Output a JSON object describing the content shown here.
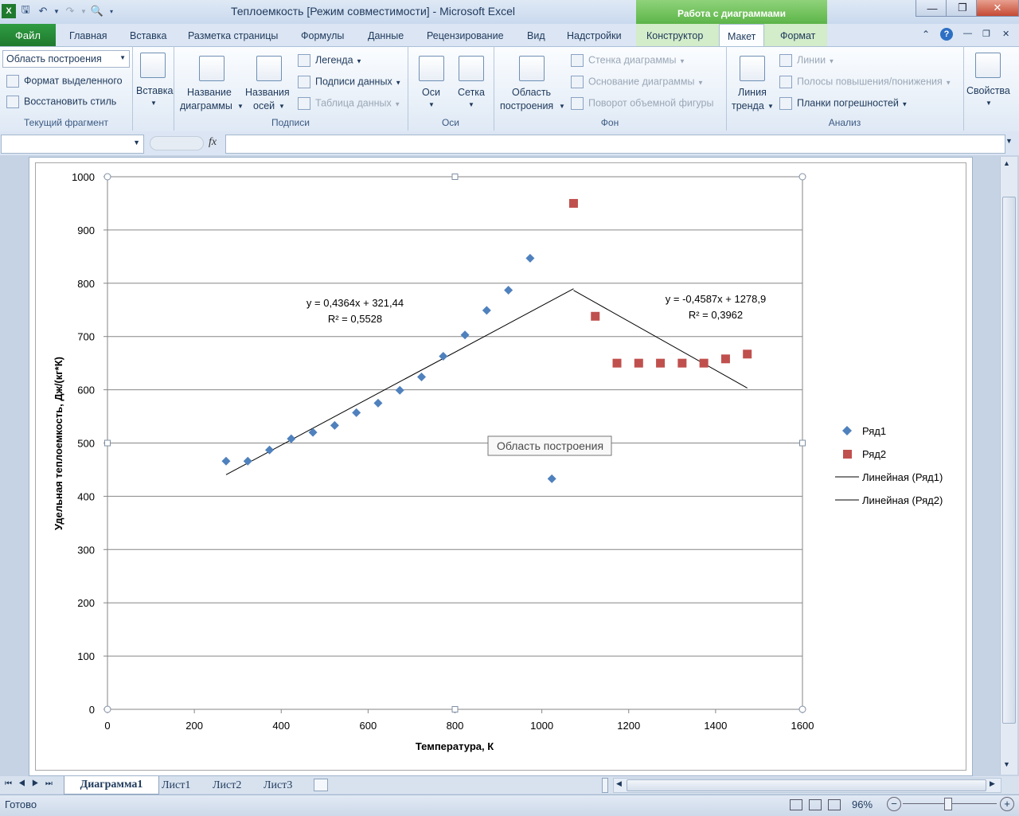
{
  "app": {
    "title": "Теплоемкость  [Режим совместимости]  -  Microsoft Excel",
    "context_tab_header": "Работа с диаграммами"
  },
  "tabs": [
    "Файл",
    "Главная",
    "Вставка",
    "Разметка страницы",
    "Формулы",
    "Данные",
    "Рецензирование",
    "Вид",
    "Надстройки",
    "Конструктор",
    "Макет",
    "Формат"
  ],
  "ribbon": {
    "current_fragment": {
      "selector_value": "Область построения",
      "format_selection": "Формат выделенного",
      "reset_style": "Восстановить стиль",
      "label": "Текущий фрагмент"
    },
    "insert": {
      "label": "Вставка"
    },
    "labels_group": {
      "chart_title_1": "Название",
      "chart_title_2": "диаграммы",
      "axis_titles_1": "Названия",
      "axis_titles_2": "осей",
      "legend": "Легенда",
      "data_labels": "Подписи данных",
      "data_table": "Таблица данных",
      "label": "Подписи"
    },
    "axes_group": {
      "axes": "Оси",
      "grid": "Сетка",
      "label": "Оси"
    },
    "background_group": {
      "plot_area_1": "Область",
      "plot_area_2": "построения",
      "chart_wall": "Стенка диаграммы",
      "chart_floor": "Основание диаграммы",
      "rotation_3d": "Поворот объемной фигуры",
      "label": "Фон"
    },
    "analysis_group": {
      "trendline_1": "Линия",
      "trendline_2": "тренда",
      "lines": "Линии",
      "updown_bars": "Полосы повышения/понижения",
      "error_bars": "Планки погрешностей",
      "label": "Анализ"
    },
    "properties_group": {
      "properties": "Свойства"
    }
  },
  "formula_bar": {
    "fx": "fx",
    "value": ""
  },
  "chart_data": {
    "type": "scatter",
    "xlabel": "Температура, К",
    "ylabel": "Удельная теплоемкость, Дж/(кг*К)",
    "xlim": [
      0,
      1600
    ],
    "ylim": [
      0,
      1000
    ],
    "xticks": [
      "0",
      "200",
      "400",
      "600",
      "800",
      "1000",
      "1200",
      "1400",
      "1600"
    ],
    "yticks": [
      "0",
      "100",
      "200",
      "300",
      "400",
      "500",
      "600",
      "700",
      "800",
      "900",
      "1000"
    ],
    "grid": "horizontal",
    "legend_position": "right",
    "series": [
      {
        "name": "Ряд1",
        "marker": "diamond",
        "color": "#4f81bd",
        "x": [
          273,
          323,
          373,
          423,
          473,
          523,
          573,
          623,
          673,
          723,
          773,
          823,
          873,
          923,
          973,
          1023
        ],
        "y": [
          466,
          466,
          487,
          508,
          520,
          533,
          557,
          575,
          599,
          624,
          663,
          703,
          749,
          787,
          847,
          433
        ]
      },
      {
        "name": "Ряд2",
        "marker": "square",
        "color": "#c0504d",
        "x": [
          1073,
          1123,
          1173,
          1223,
          1273,
          1323,
          1373,
          1423,
          1473
        ],
        "y": [
          950,
          738,
          650,
          650,
          650,
          650,
          650,
          658,
          667
        ]
      }
    ],
    "trendlines": [
      {
        "name": "Линейная (Ряд1)",
        "slope": 0.4364,
        "intercept": 321.44,
        "x_range": [
          273,
          1073
        ],
        "equation": "y = 0,4364x + 321,44",
        "r2": "R² = 0,5528"
      },
      {
        "name": "Линейная (Ряд2)",
        "slope": -0.4587,
        "intercept": 1278.9,
        "x_range": [
          1073,
          1473
        ],
        "equation": "y = -0,4587x + 1278,9",
        "r2": "R² = 0,3962"
      }
    ],
    "tooltip": "Область построения"
  },
  "sheet_tabs": [
    "Диаграмма1",
    "Лист1",
    "Лист2",
    "Лист3"
  ],
  "status": {
    "ready": "Готово",
    "zoom": "96%"
  }
}
